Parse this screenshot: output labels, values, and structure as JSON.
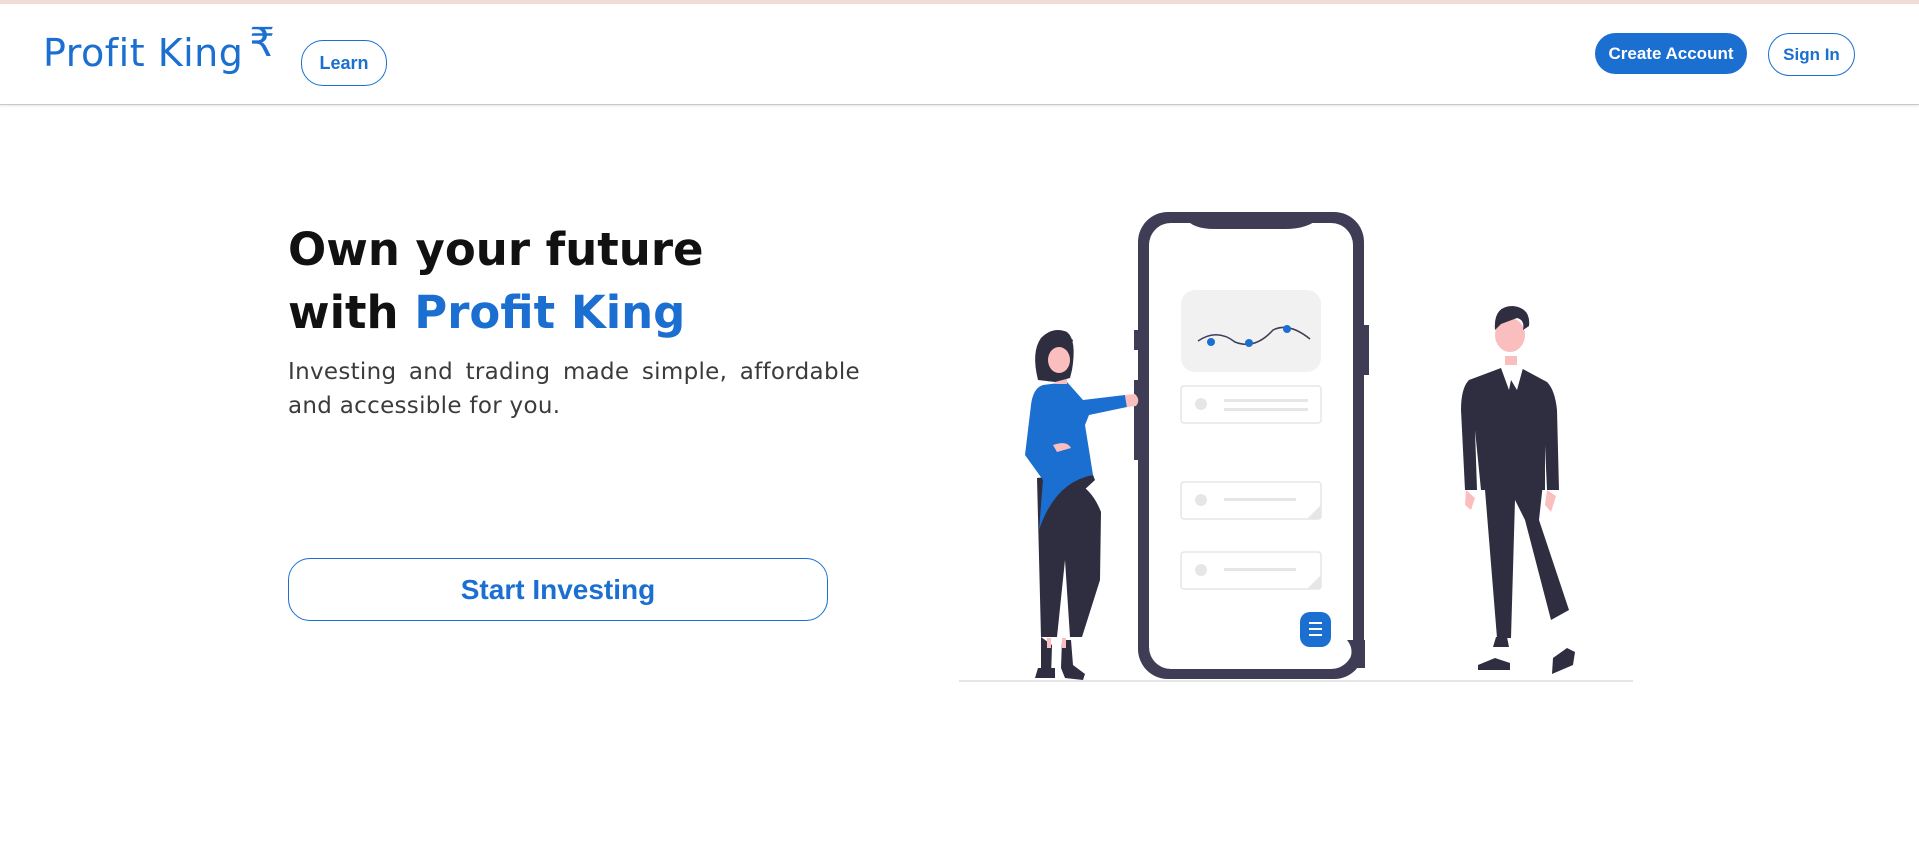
{
  "navbar": {
    "brand": "Profit King",
    "brand_symbol": "₹",
    "learn_label": "Learn",
    "create_account_label": "Create Account",
    "sign_in_label": "Sign In"
  },
  "hero": {
    "title_line1": "Own your future",
    "title_line2_prefix": "with ",
    "title_line2_accent": "Profit King",
    "subtitle": "Investing and trading made simple, affordable and accessible for you.",
    "cta_label": "Start Investing"
  },
  "colors": {
    "primary": "#1a6fd1",
    "dark_figure": "#2f2e41",
    "skin": "#fbbebe"
  },
  "icons": [
    "rupee-symbol",
    "line-chart-icon",
    "menu-icon"
  ]
}
